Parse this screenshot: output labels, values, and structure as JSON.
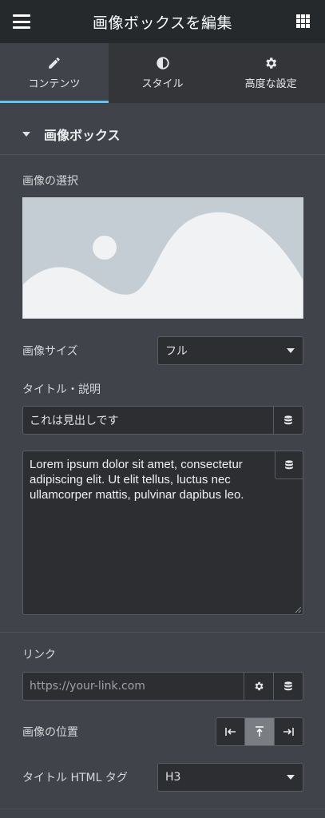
{
  "header": {
    "title": "画像ボックスを編集",
    "menu_icon": "hamburger-icon",
    "apps_icon": "grid-icon"
  },
  "tabs": [
    {
      "label": "コンテンツ",
      "icon": "pencil-icon",
      "active": true
    },
    {
      "label": "スタイル",
      "icon": "half-circle-icon",
      "active": false
    },
    {
      "label": "高度な設定",
      "icon": "gear-icon",
      "active": false
    }
  ],
  "section": {
    "title": "画像ボックス"
  },
  "image": {
    "label": "画像の選択"
  },
  "image_size": {
    "label": "画像サイズ",
    "value": "フル"
  },
  "title_desc": {
    "label": "タイトル・説明",
    "title_value": "これは見出しです",
    "description_value": "Lorem ipsum dolor sit amet, consectetur adipiscing elit. Ut elit tellus, luctus nec ullamcorper mattis, pulvinar dapibus leo."
  },
  "link": {
    "label": "リンク",
    "placeholder": "https://your-link.com"
  },
  "image_position": {
    "label": "画像の位置",
    "options": [
      "left",
      "top",
      "right"
    ],
    "selected": "top"
  },
  "title_tag": {
    "label": "タイトル HTML タグ",
    "value": "H3"
  },
  "colors": {
    "accent": "#6ec1e4",
    "panel": "#404349",
    "header": "#26292c",
    "input": "#2c2e32"
  }
}
